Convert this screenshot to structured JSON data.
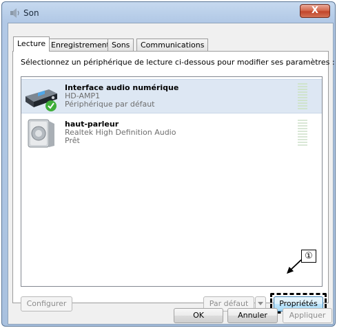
{
  "window": {
    "title": "Son",
    "close_glyph": "X"
  },
  "tabs": [
    {
      "label": "Lecture",
      "active": true
    },
    {
      "label": "Enregistrement",
      "active": false
    },
    {
      "label": "Sons",
      "active": false
    },
    {
      "label": "Communications",
      "active": false
    }
  ],
  "panel": {
    "instruction": "Sélectionnez un périphérique de lecture ci-dessous pour modifier ses paramètres :"
  },
  "devices": [
    {
      "name": "Interface audio numérique",
      "model": "HD-AMP1",
      "status": "Périphérique par défaut",
      "icon": "digital-audio-interface-icon",
      "default_badge": "checkmark-icon",
      "selected": true
    },
    {
      "name": "haut-parleur",
      "model": "Realtek High Definition Audio",
      "status": "Prêt",
      "icon": "speaker-icon",
      "selected": false
    }
  ],
  "panel_buttons": {
    "configure": "Configurer",
    "set_default": "Par défaut",
    "properties": "Propriétés"
  },
  "dialog_buttons": {
    "ok": "OK",
    "cancel": "Annuler",
    "apply": "Appliquer"
  },
  "annotation": {
    "callout_number": "①"
  },
  "colors": {
    "selection": "#dde7f3",
    "close_button": "#c2452a",
    "focus_border": "#3c7fb1"
  }
}
